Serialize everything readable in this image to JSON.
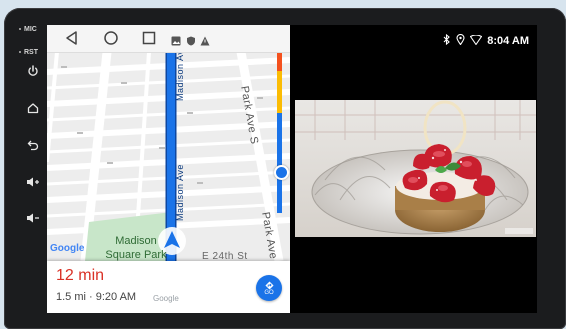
{
  "side_panel": {
    "mic_label": "MIC",
    "rst_label": "RST",
    "buttons": [
      "power-icon",
      "home-icon",
      "back-icon",
      "volume-up-icon",
      "volume-down-icon"
    ]
  },
  "android_nav": {
    "icons": [
      "back-triangle-icon",
      "home-circle-icon",
      "recents-square-icon",
      "image-icon",
      "shield-icon",
      "warning-icon"
    ]
  },
  "map": {
    "streets": {
      "madison_ave_top": "Madison Ave",
      "madison_ave_bottom": "Madison Ave",
      "park_ave_s_top": "Park Ave S",
      "park_ave_s_bottom": "Park Ave S",
      "e24th": "E 24th St"
    },
    "park_name_line1": "Madison",
    "park_name_line2": "Square Park",
    "google_logo": "Google"
  },
  "eta": {
    "time": "12 min",
    "details": "1.5 mi · 9:20 AM",
    "google": "Google",
    "go_label": "GO"
  },
  "status_bar": {
    "time": "8:04 AM",
    "icons": [
      "bluetooth-icon",
      "location-icon",
      "wifi-icon"
    ]
  },
  "colors": {
    "route_blue": "#1a73e8",
    "eta_red": "#d93025",
    "park_green": "#c8e6c9"
  }
}
